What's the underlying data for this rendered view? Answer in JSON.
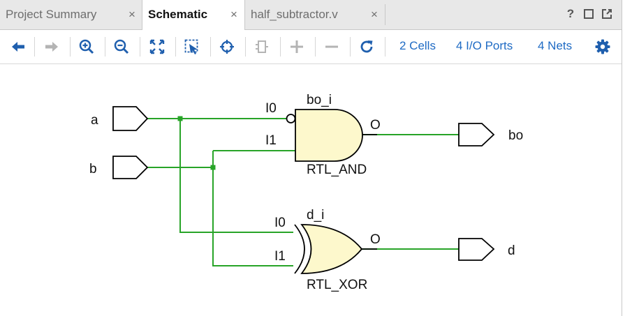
{
  "tabs": [
    {
      "label": "Project Summary",
      "close": "×",
      "active": false
    },
    {
      "label": "Schematic",
      "close": "×",
      "active": true
    },
    {
      "label": "half_subtractor.v",
      "close": "×",
      "active": false
    }
  ],
  "window_controls": {
    "help": "?"
  },
  "toolbar": {
    "icons": [
      "back-arrow-icon",
      "forward-arrow-icon",
      "zoom-in-icon",
      "zoom-out-icon",
      "zoom-fit-icon",
      "zoom-area-icon",
      "crosshair-icon",
      "cell-icon",
      "plus-icon",
      "minus-icon",
      "refresh-icon",
      "gear-icon"
    ],
    "cells": "2 Cells",
    "io_ports": "4 I/O Ports",
    "nets": "4 Nets"
  },
  "colors": {
    "wire": "#28a428",
    "gate_fill": "#fdf8cc",
    "link": "#1f6bc4",
    "icon_blue": "#1f5fae",
    "icon_disabled": "#b4b4b4"
  },
  "schematic": {
    "inputs": [
      {
        "name": "a"
      },
      {
        "name": "b"
      }
    ],
    "outputs": [
      {
        "name": "bo"
      },
      {
        "name": "d"
      }
    ],
    "cells": [
      {
        "instance": "bo_i",
        "type": "RTL_AND",
        "pins": [
          "I0",
          "I1",
          "O"
        ]
      },
      {
        "instance": "d_i",
        "type": "RTL_XOR",
        "pins": [
          "I0",
          "I1",
          "O"
        ]
      }
    ]
  }
}
